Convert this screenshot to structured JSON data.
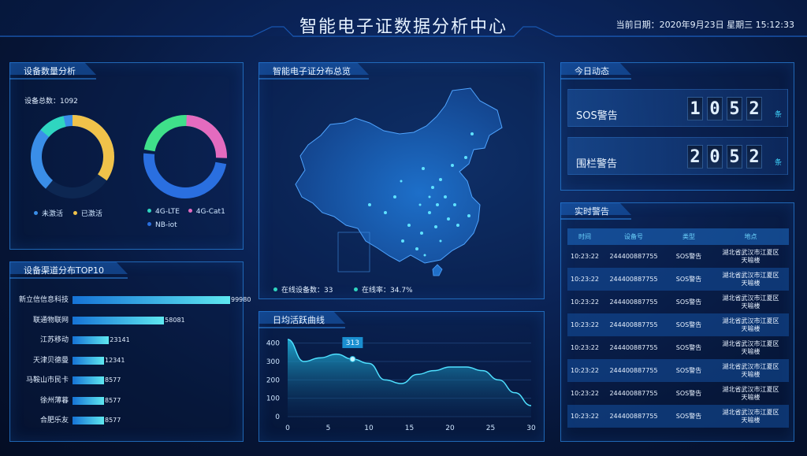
{
  "header": {
    "title": "智能电子证数据分析中心",
    "date": "当前日期：2020年9月23日 星期三 15:12:33"
  },
  "device_analysis": {
    "title": "设备数量分析",
    "total": "设备总数：1092",
    "donut1": {
      "legend": [
        {
          "label": "未激活",
          "color": "#3a8ee8"
        },
        {
          "label": "已激活",
          "color": "#f0c24a"
        }
      ]
    },
    "donut2": {
      "legend": [
        {
          "label": "4G-LTE",
          "color": "#2fd6c0"
        },
        {
          "label": "4G-Cat1",
          "color": "#e46bbf"
        },
        {
          "label": "NB-iot",
          "color": "#2a6fe0"
        }
      ]
    }
  },
  "channel": {
    "title": "设备渠道分布TOP10",
    "max": 99980,
    "items": [
      {
        "name": "新立信信息科技",
        "value": "99980",
        "n": 99980
      },
      {
        "name": "联通物联网",
        "value": "58081",
        "n": 58081
      },
      {
        "name": "江苏移动",
        "value": "23141",
        "n": 23141
      },
      {
        "name": "天津贝德曼",
        "value": "12341",
        "n": 12341
      },
      {
        "name": "马鞍山市民卡",
        "value": "8577",
        "n": 8577
      },
      {
        "name": "徐州薄暮",
        "value": "8577",
        "n": 8577
      },
      {
        "name": "合肥乐友",
        "value": "8577",
        "n": 8577
      }
    ]
  },
  "map": {
    "title": "智能电子证分布总览",
    "online": "在线设备数：33",
    "rate": "在线率：34.7%"
  },
  "activity": {
    "title": "日均活跃曲线",
    "tooltip": "313"
  },
  "chart_data": {
    "type": "area",
    "x": [
      0,
      2,
      4,
      6,
      8,
      10,
      12,
      14,
      16,
      18,
      20,
      22,
      24,
      26,
      28,
      30
    ],
    "values": [
      420,
      300,
      320,
      340,
      313,
      290,
      200,
      180,
      230,
      250,
      270,
      270,
      250,
      200,
      130,
      60
    ],
    "xticks": [
      "0",
      "5",
      "10",
      "15",
      "20",
      "25",
      "30"
    ],
    "yticks": [
      "0",
      "100",
      "200",
      "300",
      "400"
    ],
    "ylim": [
      0,
      450
    ],
    "xlim": [
      0,
      30
    ]
  },
  "today": {
    "title": "今日动态",
    "items": [
      {
        "name": "SOS警告",
        "digits": [
          "1",
          "0",
          "5",
          "2"
        ],
        "unit": "条"
      },
      {
        "name": "围栏警告",
        "digits": [
          "2",
          "0",
          "5",
          "2"
        ],
        "unit": "条"
      }
    ]
  },
  "alerts": {
    "title": "实时警告",
    "headers": [
      "时间",
      "设备号",
      "类型",
      "地点"
    ],
    "rows": [
      {
        "time": "10:23:22",
        "id": "244400887755",
        "type": "SOS警告",
        "loc1": "湖北省武汉市江夏区",
        "loc2": "天喻楼"
      },
      {
        "time": "10:23:22",
        "id": "244400887755",
        "type": "SOS警告",
        "loc1": "湖北省武汉市江夏区",
        "loc2": "天喻楼"
      },
      {
        "time": "10:23:22",
        "id": "244400887755",
        "type": "SOS警告",
        "loc1": "湖北省武汉市江夏区",
        "loc2": "天喻楼"
      },
      {
        "time": "10:23:22",
        "id": "244400887755",
        "type": "SOS警告",
        "loc1": "湖北省武汉市江夏区",
        "loc2": "天喻楼"
      },
      {
        "time": "10:23:22",
        "id": "244400887755",
        "type": "SOS警告",
        "loc1": "湖北省武汉市江夏区",
        "loc2": "天喻楼"
      },
      {
        "time": "10:23:22",
        "id": "244400887755",
        "type": "SOS警告",
        "loc1": "湖北省武汉市江夏区",
        "loc2": "天喻楼"
      },
      {
        "time": "10:23:22",
        "id": "244400887755",
        "type": "SOS警告",
        "loc1": "湖北省武汉市江夏区",
        "loc2": "天喻楼"
      },
      {
        "time": "10:23:22",
        "id": "244400887755",
        "type": "SOS警告",
        "loc1": "湖北省武汉市江夏区",
        "loc2": "天喻楼"
      }
    ]
  }
}
